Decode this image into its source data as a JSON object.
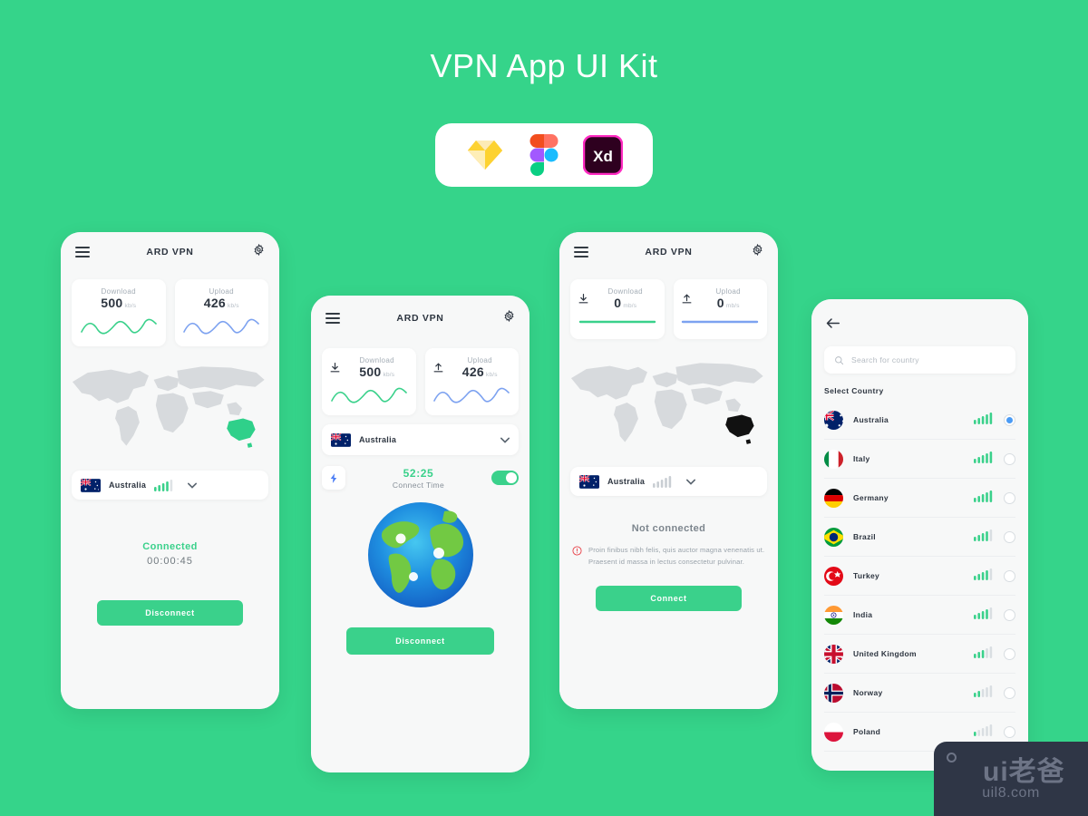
{
  "page": {
    "title": "VPN App UI Kit",
    "background_color": "#35d48a",
    "accent_green": "#3ad18b",
    "accent_blue": "#7da2f0"
  },
  "tools": [
    {
      "name": "sketch-icon",
      "label": "Sketch"
    },
    {
      "name": "figma-icon",
      "label": "Figma"
    },
    {
      "name": "adobe-xd-icon",
      "label": "Xd"
    }
  ],
  "screen1": {
    "nav_title": "ARD VPN",
    "download": {
      "label": "Download",
      "value": "500",
      "unit": "kb/s"
    },
    "upload": {
      "label": "Upload",
      "value": "426",
      "unit": "kb/s"
    },
    "country": "Australia",
    "status": "Connected",
    "timer": "00:00:45",
    "button": "Disconnect"
  },
  "screen2": {
    "nav_title": "ARD VPN",
    "download": {
      "label": "Download",
      "value": "500",
      "unit": "kb/s"
    },
    "upload": {
      "label": "Upload",
      "value": "426",
      "unit": "kb/s"
    },
    "country": "Australia",
    "connect_time": "52:25",
    "connect_time_label": "Connect Time",
    "button": "Disconnect"
  },
  "screen3": {
    "nav_title": "ARD VPN",
    "download": {
      "label": "Download",
      "value": "0",
      "unit": "mb/s"
    },
    "upload": {
      "label": "Upload",
      "value": "0",
      "unit": "mb/s"
    },
    "country": "Australia",
    "status": "Not connected",
    "notice": "Proin finibus nibh felis, quis auctor magna venenatis ut. Praesent id massa in lectus consectetur pulvinar.",
    "button": "Connect"
  },
  "screen4": {
    "search_placeholder": "Search for country",
    "section_title": "Select Country",
    "countries": [
      {
        "name": "Australia",
        "signal": 5,
        "selected": true
      },
      {
        "name": "Italy",
        "signal": 5,
        "selected": false
      },
      {
        "name": "Germany",
        "signal": 5,
        "selected": false
      },
      {
        "name": "Brazil",
        "signal": 4,
        "selected": false
      },
      {
        "name": "Turkey",
        "signal": 4,
        "selected": false
      },
      {
        "name": "India",
        "signal": 4,
        "selected": false
      },
      {
        "name": "United Kingdom",
        "signal": 3,
        "selected": false
      },
      {
        "name": "Norway",
        "signal": 2,
        "selected": false
      },
      {
        "name": "Poland",
        "signal": 1,
        "selected": false
      }
    ]
  },
  "watermark": {
    "main": "ui老爸",
    "sub": "uil8.com"
  }
}
